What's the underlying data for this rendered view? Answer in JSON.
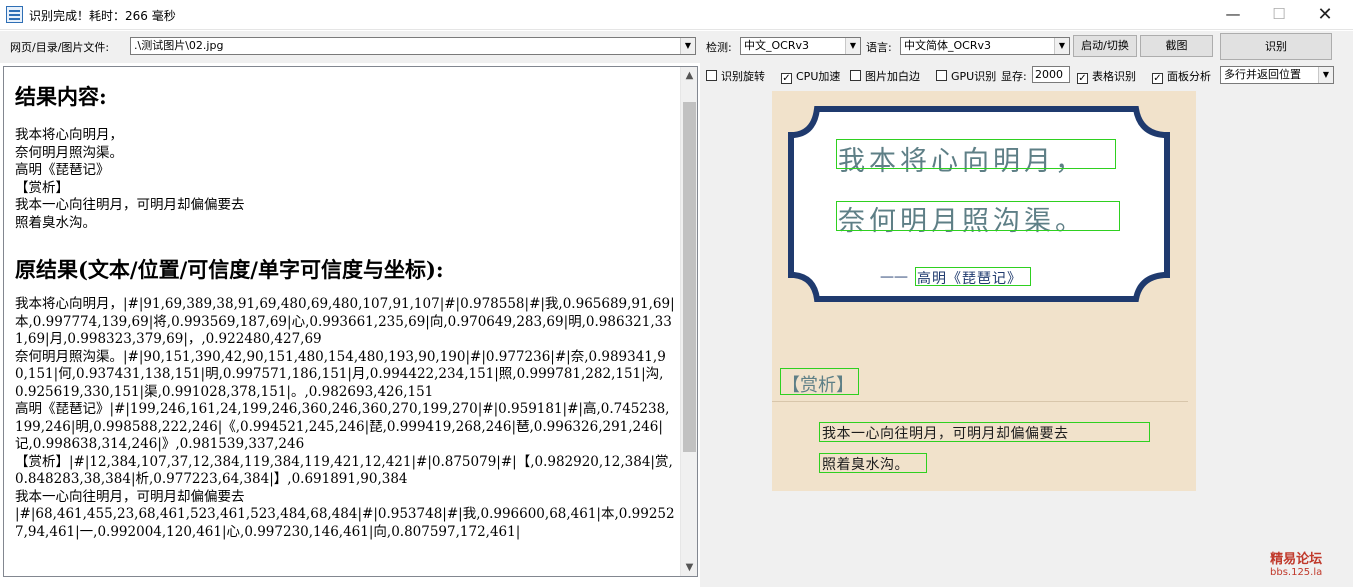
{
  "window": {
    "title": "识别完成！耗时：266 毫秒",
    "min": "—",
    "max": "☐",
    "close": "✕"
  },
  "toolbar": {
    "file_label": "网页/目录/图片文件:",
    "file_value": ".\\测试图片\\02.jpg",
    "detect_label": "检测:",
    "detect_value": "中文_OCRv3",
    "lang_label": "语言:",
    "lang_value": "中文简体_OCRv3",
    "start_switch": "启动/切换",
    "screenshot": "截图",
    "recognize": "识别"
  },
  "options": {
    "rotate": {
      "label": "识别旋转",
      "checked": false
    },
    "cpu": {
      "label": "CPU加速",
      "checked": true
    },
    "border": {
      "label": "图片加白边",
      "checked": false
    },
    "gpu": {
      "label": "GPU识别",
      "checked": false
    },
    "vram_label": "显存:",
    "vram_value": "2000",
    "table": {
      "label": "表格识别",
      "checked": true
    },
    "panel": {
      "label": "面板分析",
      "checked": true
    },
    "mode_value": "多行并返回位置"
  },
  "result": {
    "heading1": "结果内容:",
    "content_lines": "我本将心向明月，\n奈何明月照沟渠。\n高明《琵琶记》\n【赏析】\n我本一心向往明月，可明月却偏偏要去\n照着臭水沟。",
    "heading2": "原结果(文本/位置/可信度/单字可信度与坐标):",
    "raw_lines": "我本将心向明月，|#|91,69,389,38,91,69,480,69,480,107,91,107|#|0.978558|#|我,0.965689,91,69|本,0.997774,139,69|将,0.993569,187,69|心,0.993661,235,69|向,0.970649,283,69|明,0.986321,331,69|月,0.998323,379,69|，,0.922480,427,69\n奈何明月照沟渠。|#|90,151,390,42,90,151,480,154,480,193,90,190|#|0.977236|#|奈,0.989341,90,151|何,0.937431,138,151|明,0.997571,186,151|月,0.994422,234,151|照,0.999781,282,151|沟,0.925619,330,151|渠,0.991028,378,151|。,0.982693,426,151\n高明《琵琶记》|#|199,246,161,24,199,246,360,246,360,270,199,270|#|0.959181|#|高,0.745238,199,246|明,0.998588,222,246|《,0.994521,245,246|琵,0.999419,268,246|琶,0.996326,291,246|记,0.998638,314,246|》,0.981539,337,246\n【赏析】|#|12,384,107,37,12,384,119,384,119,421,12,421|#|0.875079|#|【,0.982920,12,384|赏,0.848283,38,384|析,0.977223,64,384|】,0.691891,90,384\n我本一心向往明月，可明月却偏偏要去\n|#|68,461,455,23,68,461,523,461,523,484,68,484|#|0.953748|#|我,0.996600,68,461|本,0.992527,94,461|一,0.992004,120,461|心,0.997230,146,461|向,0.807597,172,461|"
  },
  "image": {
    "line1": "我本将心向明月，",
    "line2": "奈何明月照沟渠。",
    "attribution": "高明《琵琶记》",
    "attribution_dash": "——",
    "section_title": "【赏析】",
    "comment1": "我本一心向往明月，可明月却偏偏要去",
    "comment2": "照着臭水沟。",
    "frame_color": "#1f3a6e",
    "paper_color": "#f1e2cb",
    "text_color": "#5e7f86",
    "box_color": "#2fd020"
  },
  "watermark": {
    "line1": "精易论坛",
    "line2": "bbs.125.la"
  }
}
